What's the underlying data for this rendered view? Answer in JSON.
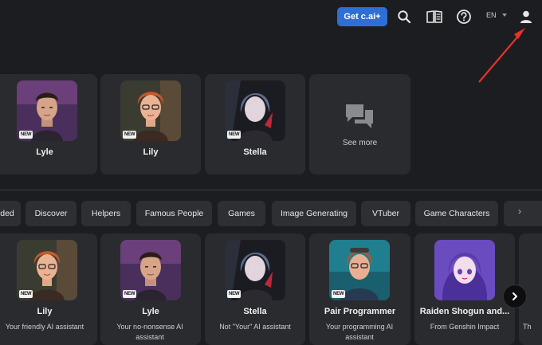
{
  "header": {
    "cta_label": "Get c.ai+",
    "lang": "EN",
    "icons": [
      "search-icon",
      "book-icon",
      "help-icon",
      "user-icon"
    ]
  },
  "recent": {
    "cards": [
      {
        "name": "Lyle",
        "badge": "NEW"
      },
      {
        "name": "Lily",
        "badge": "NEW"
      },
      {
        "name": "Stella",
        "badge": "NEW"
      },
      {
        "name": "See more"
      }
    ]
  },
  "tabs": [
    "ded",
    "Discover",
    "Helpers",
    "Famous People",
    "Games",
    "Image Generating",
    "VTuber",
    "Game Characters"
  ],
  "featured": {
    "cards": [
      {
        "name": "Lily",
        "desc": "Your friendly AI assistant",
        "badge": "NEW"
      },
      {
        "name": "Lyle",
        "desc": "Your no-nonsense AI assistant",
        "badge": "NEW"
      },
      {
        "name": "Stella",
        "desc": "Not \"Your\" AI assistant",
        "badge": "NEW"
      },
      {
        "name": "Pair Programmer",
        "desc": "Your programming AI assistant",
        "badge": "NEW"
      },
      {
        "name": "Raiden Shogun and...",
        "desc": "From Genshin Impact"
      }
    ],
    "edge_letters": "Th"
  },
  "annotation": {
    "color": "#e8322a"
  }
}
